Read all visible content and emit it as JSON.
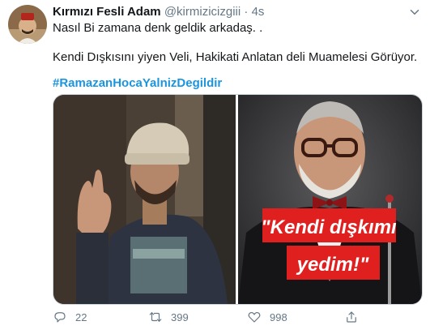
{
  "tweet": {
    "author_name": "Kırmızı Fesli Adam",
    "handle": "@kirmizicizgiii",
    "separator": "·",
    "time": "4s",
    "text_line1": "Nasıl Bi zamana denk geldik arkadaş. .",
    "text_line2": "Kendi Dışkısını yiyen Veli, Hakikati Anlatan deli Muamelesi Görüyor.",
    "hashtag": "#RamazanHocaYalnizDegildir",
    "image_right_caption_line1": "\"Kendi dışkımı",
    "image_right_caption_line2": "yedim!\""
  },
  "actions": {
    "reply_count": "22",
    "retweet_count": "399",
    "like_count": "998"
  },
  "icons": {
    "reply": "reply-icon",
    "retweet": "retweet-icon",
    "like": "like-icon",
    "share": "share-icon",
    "more": "chevron-down-icon"
  },
  "colors": {
    "link": "#1b95e0",
    "muted": "#657786",
    "caption_bg": "#e0201f"
  }
}
